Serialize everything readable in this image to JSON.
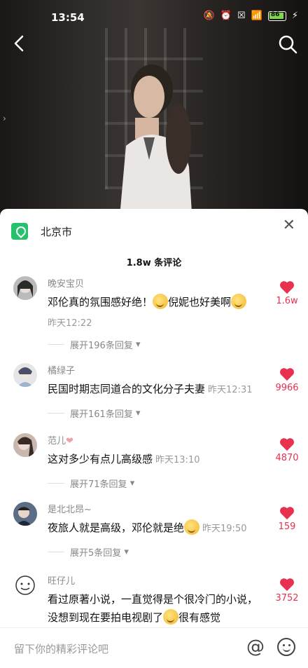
{
  "status_bar": {
    "time": "13:54",
    "battery": "86"
  },
  "location": {
    "city": "北京市"
  },
  "comments_header": {
    "count_label": "1.8w 条评论"
  },
  "comments": [
    {
      "user": "晚安宝贝",
      "text_a": "邓伦真的氛围感好绝！",
      "text_b": "倪妮也好美啊",
      "time": "昨天12:22",
      "likes": "1.6w",
      "expand": "展开196条回复"
    },
    {
      "user": "橘绿子",
      "text": "民国时期志同道合的文化分子夫妻",
      "time": "昨天12:31",
      "likes": "9966",
      "expand": "展开161条回复"
    },
    {
      "user": "范儿",
      "text": "这对多少有点儿高级感",
      "time": "昨天13:10",
      "likes": "4870",
      "expand": "展开71条回复"
    },
    {
      "user": "是北北昂~",
      "text": "夜旅人就是高级，邓伦就是绝",
      "time": "昨天19:50",
      "likes": "159",
      "expand": "展开5条回复"
    },
    {
      "user": "旺仔儿",
      "text_a": "看过原著小说，一直觉得是个很冷门的小说，没想到现在要拍电视剧了",
      "text_b": "很有感觉",
      "likes": "3752"
    }
  ],
  "input": {
    "placeholder": "留下你的精彩评论吧"
  },
  "colors": {
    "accent": "#e8304f",
    "location_green": "#25c26e"
  },
  "icons": [
    "back-icon",
    "search-icon",
    "location-icon",
    "close-icon",
    "heart-icon",
    "at-icon",
    "emoji-icon",
    "dropdown-icon"
  ]
}
